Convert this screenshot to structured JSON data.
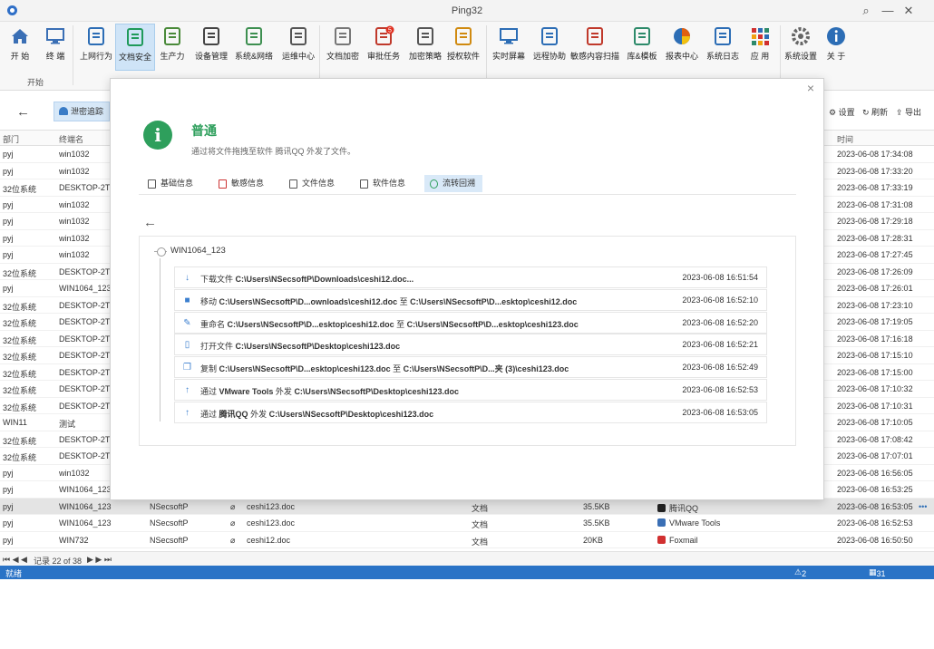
{
  "window": {
    "title": "Ping32"
  },
  "ribbon": {
    "group_label": "开始",
    "buttons": [
      {
        "label": "开 始",
        "icon": "home-icon"
      },
      {
        "label": "终 端",
        "icon": "monitor-icon"
      },
      {
        "label": "上网行为",
        "icon": "globe-search-icon"
      },
      {
        "label": "文档安全",
        "icon": "doc-shield-icon"
      },
      {
        "label": "生产力",
        "icon": "chart-icon"
      },
      {
        "label": "设备管理",
        "icon": "usb-icon"
      },
      {
        "label": "系统&网络",
        "icon": "shield-grid-icon"
      },
      {
        "label": "运维中心",
        "icon": "wand-icon"
      },
      {
        "label": "文档加密",
        "icon": "cube-icon"
      },
      {
        "label": "审批任务",
        "icon": "approve-icon"
      },
      {
        "label": "加密策略",
        "icon": "lock-policy-icon"
      },
      {
        "label": "授权软件",
        "icon": "pen-icon"
      },
      {
        "label": "实时屏幕",
        "icon": "screen-icon"
      },
      {
        "label": "远程协助",
        "icon": "remote-icon"
      },
      {
        "label": "敏感内容扫描",
        "icon": "scan-icon"
      },
      {
        "label": "库&模板",
        "icon": "database-icon"
      },
      {
        "label": "报表中心",
        "icon": "pie-icon"
      },
      {
        "label": "系统日志",
        "icon": "log-icon"
      },
      {
        "label": "应 用",
        "icon": "apps-icon"
      },
      {
        "label": "系统设置",
        "icon": "gear-icon"
      },
      {
        "label": "关 于",
        "icon": "info-icon"
      }
    ],
    "badge": "5"
  },
  "toolbar": {
    "leak_label": "泄密追踪",
    "settings": "设置",
    "refresh": "刷新",
    "export": "导出"
  },
  "grid": {
    "headers": {
      "dept": "部门",
      "terminal": "终端名",
      "time": "时间"
    },
    "rows": [
      {
        "dept": "pyj",
        "term": "win1032",
        "time": "2023-06-08 17:34:08"
      },
      {
        "dept": "pyj",
        "term": "win1032",
        "time": "2023-06-08 17:33:20"
      },
      {
        "dept": "32位系统",
        "term": "DESKTOP-2TU",
        "time": "2023-06-08 17:33:19"
      },
      {
        "dept": "pyj",
        "term": "win1032",
        "time": "2023-06-08 17:31:08"
      },
      {
        "dept": "pyj",
        "term": "win1032",
        "time": "2023-06-08 17:29:18"
      },
      {
        "dept": "pyj",
        "term": "win1032",
        "time": "2023-06-08 17:28:31"
      },
      {
        "dept": "pyj",
        "term": "win1032",
        "time": "2023-06-08 17:27:45"
      },
      {
        "dept": "32位系统",
        "term": "DESKTOP-2TU",
        "time": "2023-06-08 17:26:09"
      },
      {
        "dept": "pyj",
        "term": "WIN1064_123",
        "time": "2023-06-08 17:26:01"
      },
      {
        "dept": "32位系统",
        "term": "DESKTOP-2TU",
        "time": "2023-06-08 17:23:10"
      },
      {
        "dept": "32位系统",
        "term": "DESKTOP-2TU",
        "time": "2023-06-08 17:19:05"
      },
      {
        "dept": "32位系统",
        "term": "DESKTOP-2TU",
        "time": "2023-06-08 17:16:18"
      },
      {
        "dept": "32位系统",
        "term": "DESKTOP-2TU",
        "time": "2023-06-08 17:15:10"
      },
      {
        "dept": "32位系统",
        "term": "DESKTOP-2TU",
        "time": "2023-06-08 17:15:00"
      },
      {
        "dept": "32位系统",
        "term": "DESKTOP-2TU",
        "time": "2023-06-08 17:10:32"
      },
      {
        "dept": "32位系统",
        "term": "DESKTOP-2TU",
        "time": "2023-06-08 17:10:31"
      },
      {
        "dept": "WIN11",
        "term": "测试",
        "time": "2023-06-08 17:10:05"
      },
      {
        "dept": "32位系统",
        "term": "DESKTOP-2TU",
        "time": "2023-06-08 17:08:42"
      },
      {
        "dept": "32位系统",
        "term": "DESKTOP-2TU",
        "time": "2023-06-08 17:07:01"
      },
      {
        "dept": "pyj",
        "term": "win1032",
        "time": "2023-06-08 16:56:05"
      },
      {
        "dept": "pyj",
        "term": "WIN1064_123",
        "time": "2023-06-08 16:53:25"
      },
      {
        "dept": "pyj",
        "term": "WIN1064_123",
        "user": "NSecsoftP",
        "file": "ceshi123.doc",
        "type": "文档",
        "size": "35.5KB",
        "app": "腾讯QQ",
        "time": "2023-06-08 16:53:05",
        "more": "•••"
      },
      {
        "dept": "pyj",
        "term": "WIN1064_123",
        "user": "NSecsoftP",
        "file": "ceshi123.doc",
        "type": "文档",
        "size": "35.5KB",
        "app": "VMware Tools",
        "time": "2023-06-08 16:52:53"
      },
      {
        "dept": "pyj",
        "term": "WIN732",
        "user": "NSecsoftP",
        "file": "ceshi12.doc",
        "type": "文档",
        "size": "20KB",
        "app": "Foxmail",
        "time": "2023-06-08 16:50:50"
      }
    ],
    "pager": "记录 22 of 38"
  },
  "status": {
    "ready": "就绪",
    "compat": "2个兼容性问题",
    "unread": "31条未读告警"
  },
  "overlay": {
    "close": "×",
    "info_glyph": "i",
    "title": "普通",
    "desc": "通过将文件拖拽至软件 腾讯QQ 外发了文件。",
    "tabs": [
      "基础信息",
      "敏感信息",
      "文件信息",
      "软件信息",
      "流转回溯"
    ],
    "node": "WIN1064_123",
    "events": [
      {
        "icon": "download-icon",
        "glyph": "↓",
        "action": "下载文件",
        "p1": "C:\\Users\\NSecsoftP\\Downloads\\ceshi12.doc...",
        "mid": "",
        "p2": "",
        "time": "2023-06-08 16:51:54"
      },
      {
        "icon": "move-icon",
        "glyph": "■",
        "action": "移动",
        "p1": "C:\\Users\\NSecsoftP\\D...ownloads\\ceshi12.doc",
        "mid": "至",
        "p2": "C:\\Users\\NSecsoftP\\D...esktop\\ceshi12.doc",
        "time": "2023-06-08 16:52:10"
      },
      {
        "icon": "rename-icon",
        "glyph": "✎",
        "action": "重命名",
        "p1": "C:\\Users\\NSecsoftP\\D...esktop\\ceshi12.doc",
        "mid": "至",
        "p2": "C:\\Users\\NSecsoftP\\D...esktop\\ceshi123.doc",
        "time": "2023-06-08 16:52:20"
      },
      {
        "icon": "open-file-icon",
        "glyph": "▯",
        "action": "打开文件",
        "p1": "C:\\Users\\NSecsoftP\\Desktop\\ceshi123.doc",
        "mid": "",
        "p2": "",
        "time": "2023-06-08 16:52:21"
      },
      {
        "icon": "copy-icon",
        "glyph": "❐",
        "action": "复制",
        "p1": "C:\\Users\\NSecsoftP\\D...esktop\\ceshi123.doc",
        "mid": "至",
        "p2": "C:\\Users\\NSecsoftP\\D...夹 (3)\\ceshi123.doc",
        "time": "2023-06-08 16:52:49"
      },
      {
        "icon": "send-out-icon",
        "glyph": "↑",
        "action": "通过",
        "p1": "VMware Tools",
        "mid": "外发",
        "p2": "C:\\Users\\NSecsoftP\\Desktop\\ceshi123.doc",
        "time": "2023-06-08 16:52:53"
      },
      {
        "icon": "send-out-icon",
        "glyph": "↑",
        "action": "通过",
        "p1": "腾讯QQ",
        "mid": "外发",
        "p2": "C:\\Users\\NSecsoftP\\Desktop\\ceshi123.doc",
        "time": "2023-06-08 16:53:05"
      }
    ]
  }
}
